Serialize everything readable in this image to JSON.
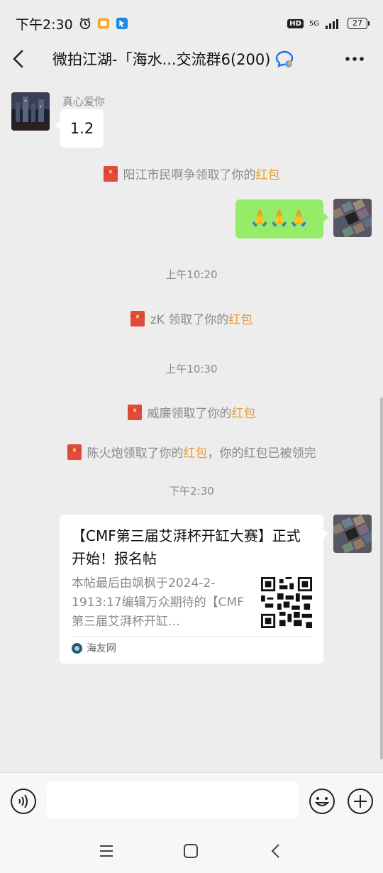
{
  "status": {
    "time": "下午2:30",
    "hd": "HD",
    "network": "5G",
    "battery": "27"
  },
  "header": {
    "title": "微拍江湖-「海水...交流群6(200)"
  },
  "messages": {
    "m1_sender": "真心爱你",
    "m1_text": "1.2",
    "sys1_text": "阳江市民啊争领取了你的",
    "hongbao_word": "红包",
    "m2_text": "🙏🙏🙏",
    "ts1": "上午10:20",
    "sys2_text": "zK 领取了你的",
    "ts2": "上午10:30",
    "sys3_text": "威廉领取了你的",
    "sys4_text": "陈火炮领取了你的",
    "sys4_suffix": "，你的红包已被领完",
    "ts3": "下午2:30"
  },
  "link_card": {
    "title": "【CMF第三届艾湃杯开缸大赛】正式开始！报名帖",
    "desc": "本帖最后由飒枫于2024-2-1913:17编辑万众期待的【CMF第三届艾湃杯开缸…",
    "source": "海友网"
  },
  "colors": {
    "background": "#ededed",
    "outgoing_bubble": "#95ec69",
    "hongbao_accent": "#ea9b2d",
    "red_packet": "#e24a3b"
  },
  "icons": {
    "back": "back-arrow-icon",
    "more": "more-dots-icon",
    "voice": "voice-icon",
    "emoji": "emoji-icon",
    "plus": "plus-icon"
  }
}
